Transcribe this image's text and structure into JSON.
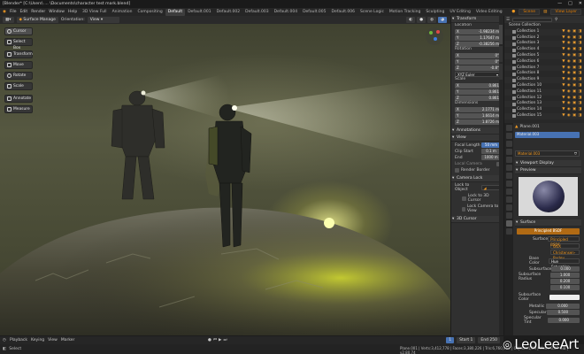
{
  "title_bar": {
    "text": "[Blender* [C:\\Users\\ ... \\Documents\\character test mark.blend]"
  },
  "menu": [
    "File",
    "Edit",
    "Render",
    "Window",
    "Help"
  ],
  "workspace_tabs": [
    "3D View Full",
    "Animation",
    "Compositing",
    "Default",
    "Default.001",
    "Default.002",
    "Default.003",
    "Default.004",
    "Default.005",
    "Default.006",
    "Scene Logic",
    "Motion Tracking",
    "Sculpting",
    "UV Editing",
    "Video Editing"
  ],
  "active_workspace": "Default",
  "scene_name": "Scene",
  "view_layer": "View Layer",
  "viewport_header": {
    "mode": "Surface Manage",
    "orientation_label": "Orientation:",
    "orientation_value": "View"
  },
  "toolbar": [
    {
      "label": "Cursor",
      "icon": "cursor-icon"
    },
    {
      "label": "Select Box",
      "icon": "select-box-icon"
    },
    {
      "label": "Transform",
      "icon": "transform-icon"
    },
    {
      "label": "Move",
      "icon": "move-icon"
    },
    {
      "label": "Rotate",
      "icon": "rotate-icon"
    },
    {
      "label": "Scale",
      "icon": "scale-icon"
    },
    {
      "label": "Annotate",
      "icon": "annotate-icon"
    },
    {
      "label": "Measure",
      "icon": "measure-icon"
    }
  ],
  "npanel": {
    "transform": {
      "title": "Transform",
      "location_label": "Location",
      "location": [
        {
          "axis": "X",
          "value": "-1.98234 m"
        },
        {
          "axis": "Y",
          "value": "1.17647 m"
        },
        {
          "axis": "Z",
          "value": "-0.38256 m"
        }
      ],
      "rotation_label": "Rotation",
      "rotation": [
        {
          "axis": "X",
          "value": "0°"
        },
        {
          "axis": "Y",
          "value": "0°"
        },
        {
          "axis": "Z",
          "value": "-0.8°"
        }
      ],
      "rotation_mode": "XYZ Euler",
      "scale_label": "Scale",
      "scale": [
        {
          "axis": "X",
          "value": "0.861"
        },
        {
          "axis": "Y",
          "value": "0.861"
        },
        {
          "axis": "Z",
          "value": "0.861"
        }
      ],
      "dimensions_label": "Dimensions",
      "dimensions": [
        {
          "axis": "X",
          "value": "2.1771 m"
        },
        {
          "axis": "Y",
          "value": "1.6614 m"
        },
        {
          "axis": "Z",
          "value": "1.8726 m"
        }
      ]
    },
    "annotations_title": "Annotations",
    "view": {
      "title": "View",
      "focal_length_label": "Focal Length",
      "focal_length": "50 mm",
      "clip_start_label": "Clip Start",
      "clip_start": "0.1 m",
      "clip_end_label": "End",
      "clip_end": "1000 m",
      "local_camera_label": "Local Camera",
      "render_border": "Render Border"
    },
    "camera_lock": {
      "title": "Camera Lock",
      "lock_to_object": "Lock to Object",
      "lock_to_3d_cursor": "Lock to 3D Cursor",
      "lock_camera_to_view": "Lock Camera to View"
    },
    "cursor_title": "3D Cursor"
  },
  "outliner": {
    "title": "Scene Collection",
    "rows": [
      "Collection 1",
      "Collection 2",
      "Collection 3",
      "Collection 4",
      "Collection 5",
      "Collection 6",
      "Collection 7",
      "Collection 8",
      "Collection 9",
      "Collection 10",
      "Collection 11",
      "Collection 12",
      "Collection 13",
      "Collection 14",
      "Collection 15"
    ]
  },
  "properties": {
    "object_name": "Plane.001",
    "material_slot": "Material.003",
    "material_name": "Material.003",
    "viewport_display_label": "Viewport Display",
    "preview_label": "Preview",
    "surface_label": "Surface",
    "surface_value": "Principled BSDF",
    "surface_shader_label": "Surface",
    "surface_shader_value": "Principled BSDF",
    "distribution": "GGX",
    "subsurface_method": "Christensen-Burley",
    "base_color_label": "Base Color",
    "base_color_value": "Hue Saturation",
    "subsurface_label": "Subsurface",
    "subsurface_value": "0.000",
    "subsurface_radius_label": "Subsurface Radius",
    "subsurface_radius": [
      "1.000",
      "0.200",
      "0.100"
    ],
    "subsurface_color_label": "Subsurface Color",
    "metallic_label": "Metallic",
    "metallic": "0.000",
    "specular_label": "Specular",
    "specular": "0.500",
    "specular_tint_label": "Specular Tint",
    "specular_tint": "0.000"
  },
  "timeline": {
    "playback": "Playback",
    "keying": "Keying",
    "view": "View",
    "marker": "Marker",
    "frame": "1",
    "start_label": "Start",
    "start": "1",
    "end_label": "End",
    "end": "250"
  },
  "status_bar": {
    "left": "Select",
    "right": "Plane.001 | Verts:3,412,778 | Faces:3,380,226 | Tris:6,760,452 | Objects:1/39 | Mem: 3.07 GiB | v2.80.74"
  },
  "watermark": "LeoLeeArt",
  "colors": {
    "accent": "#f29a22",
    "selection": "#4772b3",
    "panel": "#303030",
    "background": "#1d1d1d"
  }
}
